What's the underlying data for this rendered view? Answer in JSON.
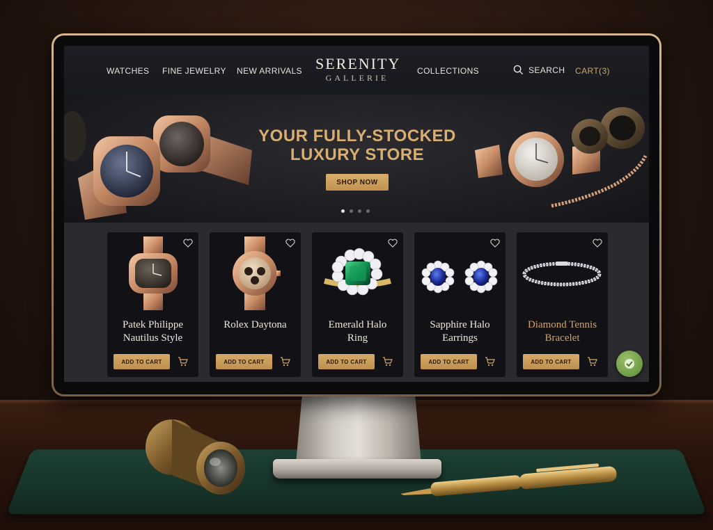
{
  "nav": {
    "watches": "WATCHES",
    "fine_jewelry": "FINE JEWELRY",
    "new_arrivals": "NEW ARRIVALS",
    "collections": "COLLECTIONS",
    "search": "SEARCH",
    "cart": "CART(3)"
  },
  "logo": {
    "main": "SERENITY",
    "sub": "GALLERIE"
  },
  "hero": {
    "title_line1": "YOUR FULLY-STOCKED",
    "title_line2": "LUXURY STORE",
    "cta": "SHOP NOW",
    "slides": 4,
    "active_slide": 1
  },
  "products": [
    {
      "name_line1": "Patek Philippe",
      "name_line2": "Nautilus Style",
      "button": "ADD TO CART",
      "icon": "watch-icon"
    },
    {
      "name_line1": "Rolex Daytona",
      "name_line2": "",
      "button": "ADD TO CART",
      "icon": "chronograph-icon"
    },
    {
      "name_line1": "Emerald Halo",
      "name_line2": "Ring",
      "button": "ADD TO CART",
      "icon": "emerald-ring-icon"
    },
    {
      "name_line1": "Sapphire Halo",
      "name_line2": "Earrings",
      "button": "ADD TO CART",
      "icon": "sapphire-earrings-icon"
    },
    {
      "name_line1": "Diamond Tennis",
      "name_line2": "Bracelet",
      "button": "ADD TO CART",
      "icon": "bracelet-icon"
    }
  ],
  "colors": {
    "accent_gold": "#d8ae72",
    "button_gold": "#c9995a",
    "header_bg": "#1b1c21",
    "card_bg": "#121216",
    "chat_green": "#7aa34c"
  }
}
